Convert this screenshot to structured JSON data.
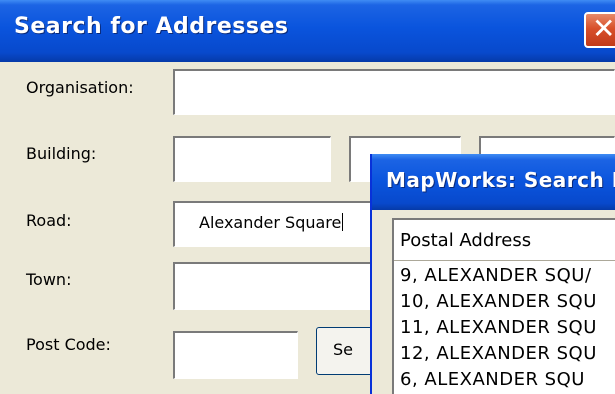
{
  "dialog": {
    "title": "Search for Addresses",
    "fields": {
      "organisation": {
        "label": "Organisation:",
        "value": ""
      },
      "building": {
        "label": "Building:",
        "values": [
          "",
          "",
          ""
        ]
      },
      "road": {
        "label": "Road:",
        "value": "Alexander Square"
      },
      "town": {
        "label": "Town:",
        "value": ""
      },
      "postcode": {
        "label": "Post Code:",
        "value": ""
      }
    },
    "search_button_label": "Se"
  },
  "results_window": {
    "title": "MapWorks: Search I",
    "column_header": "Postal Address",
    "items": [
      "9, ALEXANDER SQU/",
      "10, ALEXANDER SQU",
      "11, ALEXANDER SQU",
      "12, ALEXANDER SQU",
      "6, ALEXANDER SQU"
    ]
  }
}
